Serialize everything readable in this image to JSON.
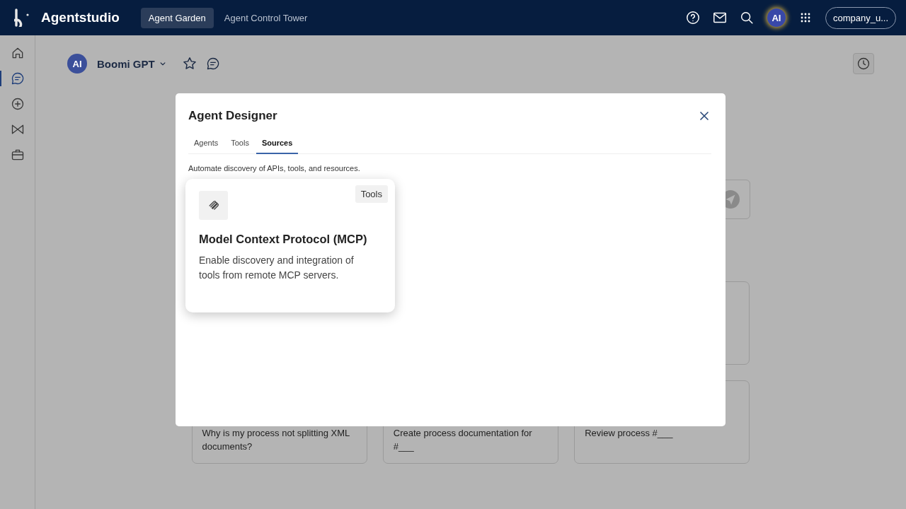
{
  "header": {
    "logo": "Agentstudio",
    "nav": [
      {
        "label": "Agent Garden",
        "selected": true
      },
      {
        "label": "Agent Control Tower",
        "selected": false
      }
    ],
    "avatar": "AI",
    "account": "company_u..."
  },
  "sidebar": {
    "items": [
      {
        "kind": "home",
        "selected": false
      },
      {
        "kind": "chat",
        "selected": true
      },
      {
        "kind": "add",
        "selected": false
      },
      {
        "kind": "bowtie",
        "selected": false
      },
      {
        "kind": "briefcase",
        "selected": false
      }
    ]
  },
  "chat": {
    "avatar": "AI",
    "name": "Boomi GPT",
    "prompts": [
      "Why is my process not splitting XML documents?",
      "Create process documentation for #___",
      "Review process #___"
    ]
  },
  "modal": {
    "title": "Agent Designer",
    "tabs": [
      {
        "label": "Agents",
        "selected": false
      },
      {
        "label": "Tools",
        "selected": false
      },
      {
        "label": "Sources",
        "selected": true
      }
    ],
    "description": "Automate discovery of APIs, tools, and resources.",
    "sources": [
      {
        "tag": "Tools",
        "title": "Model Context Protocol (MCP)",
        "description": "Enable discovery and integration of tools from remote MCP servers."
      }
    ]
  }
}
